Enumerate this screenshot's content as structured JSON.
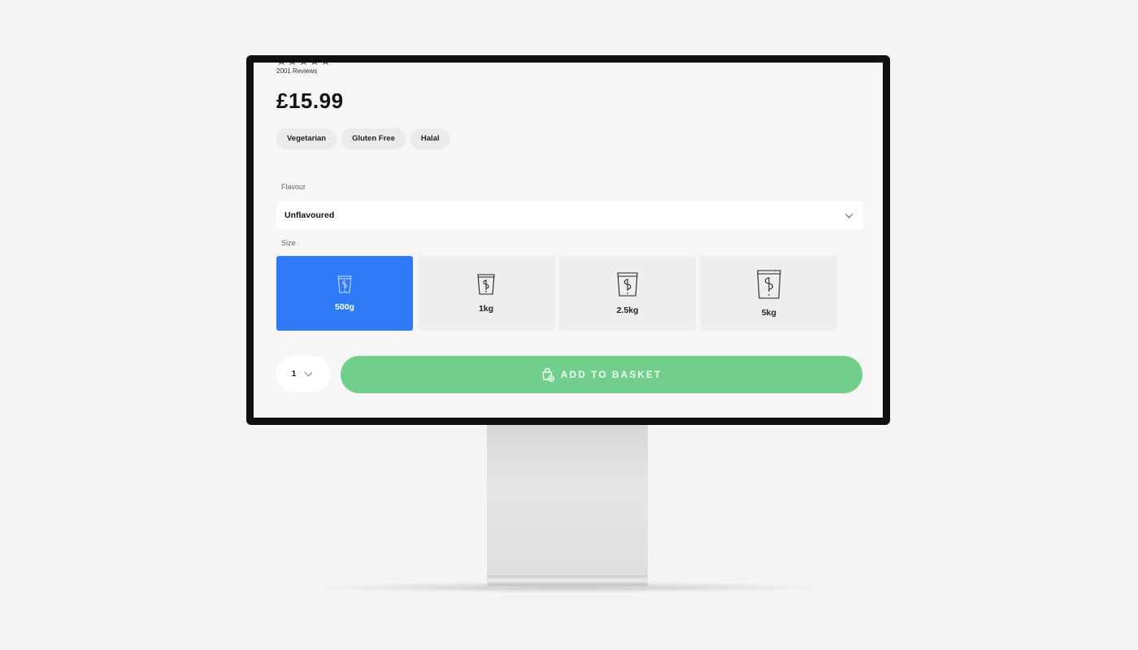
{
  "product": {
    "rating_stars": "★★★★★",
    "reviews": "2001 Reviews",
    "price": "£15.99",
    "tags": [
      "Vegetarian",
      "Gluten Free",
      "Halal"
    ]
  },
  "flavour": {
    "label": "Flavour",
    "selected": "Unflavoured",
    "icon": "chevron-down-icon"
  },
  "size": {
    "label": "Size",
    "options": [
      {
        "label": "500g",
        "selected": true,
        "icon": "pouch-icon"
      },
      {
        "label": "1kg",
        "selected": false,
        "icon": "pouch-icon"
      },
      {
        "label": "2.5kg",
        "selected": false,
        "icon": "pouch-icon"
      },
      {
        "label": "5kg",
        "selected": false,
        "icon": "pouch-icon"
      }
    ]
  },
  "quantity": {
    "value": "1",
    "icon": "chevron-down-icon"
  },
  "add_to_basket": {
    "label": "ADD TO BASKET",
    "icon": "basket-add-icon"
  },
  "colors": {
    "selected_size": "#2f7af6",
    "add_button": "#72cf8b",
    "background": "#f4f4f4",
    "monitor_bezel": "#101010"
  }
}
